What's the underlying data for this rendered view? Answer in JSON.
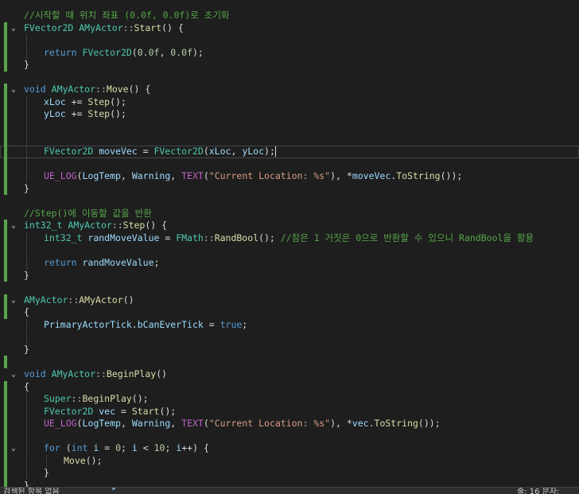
{
  "editor": {
    "language": "cpp",
    "current_line_index": 11,
    "colors": {
      "background": "#1e1e1e",
      "keyword": "#569cd6",
      "type": "#4ec9b0",
      "comment": "#57a64a",
      "string": "#d69d85",
      "number": "#b5cea8",
      "function": "#dcdcaa",
      "default": "#dcdcdc",
      "change_bar": "#57a64a"
    },
    "lines": [
      {
        "indent": 0,
        "fold": "",
        "tokens": [
          {
            "k": "c",
            "t": "//시작할 때 위치 좌표 (0.0f, 0.0f)로 초기화"
          }
        ]
      },
      {
        "indent": 0,
        "fold": "v",
        "tokens": [
          {
            "k": "t",
            "t": "FVector2D"
          },
          {
            "k": "d",
            "t": " "
          },
          {
            "k": "t",
            "t": "AMyActor"
          },
          {
            "k": "p",
            "t": "::"
          },
          {
            "k": "f",
            "t": "Start"
          },
          {
            "k": "d",
            "t": "() {"
          }
        ]
      },
      {
        "indent": 1,
        "fold": "",
        "tokens": []
      },
      {
        "indent": 1,
        "fold": "",
        "tokens": [
          {
            "k": "k",
            "t": "return"
          },
          {
            "k": "d",
            "t": " "
          },
          {
            "k": "t",
            "t": "FVector2D"
          },
          {
            "k": "d",
            "t": "("
          },
          {
            "k": "n",
            "t": "0.0f"
          },
          {
            "k": "d",
            "t": ", "
          },
          {
            "k": "n",
            "t": "0.0f"
          },
          {
            "k": "d",
            "t": ");"
          }
        ]
      },
      {
        "indent": 0,
        "fold": "",
        "tokens": [
          {
            "k": "d",
            "t": "}"
          }
        ]
      },
      {
        "indent": 0,
        "fold": "",
        "tokens": []
      },
      {
        "indent": 0,
        "fold": "v",
        "tokens": [
          {
            "k": "k",
            "t": "void"
          },
          {
            "k": "d",
            "t": " "
          },
          {
            "k": "t",
            "t": "AMyActor"
          },
          {
            "k": "p",
            "t": "::"
          },
          {
            "k": "f",
            "t": "Move"
          },
          {
            "k": "d",
            "t": "() {"
          }
        ]
      },
      {
        "indent": 1,
        "fold": "",
        "tokens": [
          {
            "k": "v",
            "t": "xLoc"
          },
          {
            "k": "d",
            "t": " += "
          },
          {
            "k": "f",
            "t": "Step"
          },
          {
            "k": "d",
            "t": "();"
          }
        ]
      },
      {
        "indent": 1,
        "fold": "",
        "tokens": [
          {
            "k": "v",
            "t": "yLoc"
          },
          {
            "k": "d",
            "t": " += "
          },
          {
            "k": "f",
            "t": "Step"
          },
          {
            "k": "d",
            "t": "();"
          }
        ]
      },
      {
        "indent": 1,
        "fold": "",
        "tokens": []
      },
      {
        "indent": 1,
        "fold": "",
        "tokens": []
      },
      {
        "indent": 1,
        "fold": "",
        "tokens": [
          {
            "k": "t",
            "t": "FVector2D"
          },
          {
            "k": "d",
            "t": " "
          },
          {
            "k": "v",
            "t": "moveVec"
          },
          {
            "k": "d",
            "t": " = "
          },
          {
            "k": "t",
            "t": "FVector2D"
          },
          {
            "k": "d",
            "t": "("
          },
          {
            "k": "v",
            "t": "xLoc"
          },
          {
            "k": "d",
            "t": ", "
          },
          {
            "k": "v",
            "t": "yLoc"
          },
          {
            "k": "d",
            "t": ");"
          }
        ]
      },
      {
        "indent": 1,
        "fold": "",
        "tokens": []
      },
      {
        "indent": 1,
        "fold": "",
        "tokens": [
          {
            "k": "m",
            "t": "UE_LOG"
          },
          {
            "k": "d",
            "t": "("
          },
          {
            "k": "v",
            "t": "LogTemp"
          },
          {
            "k": "d",
            "t": ", "
          },
          {
            "k": "v",
            "t": "Warning"
          },
          {
            "k": "d",
            "t": ", "
          },
          {
            "k": "m",
            "t": "TEXT"
          },
          {
            "k": "d",
            "t": "("
          },
          {
            "k": "s",
            "t": "\"Current Location: %s\""
          },
          {
            "k": "d",
            "t": "), *"
          },
          {
            "k": "v",
            "t": "moveVec"
          },
          {
            "k": "d",
            "t": "."
          },
          {
            "k": "f",
            "t": "ToString"
          },
          {
            "k": "d",
            "t": "());"
          }
        ]
      },
      {
        "indent": 0,
        "fold": "",
        "tokens": [
          {
            "k": "d",
            "t": "}"
          }
        ]
      },
      {
        "indent": 0,
        "fold": "",
        "tokens": []
      },
      {
        "indent": 0,
        "fold": "",
        "tokens": [
          {
            "k": "c",
            "t": "//Step()에 이동할 값을 반환"
          }
        ]
      },
      {
        "indent": 0,
        "fold": "v",
        "tokens": [
          {
            "k": "t",
            "t": "int32_t"
          },
          {
            "k": "d",
            "t": " "
          },
          {
            "k": "t",
            "t": "AMyActor"
          },
          {
            "k": "p",
            "t": "::"
          },
          {
            "k": "f",
            "t": "Step"
          },
          {
            "k": "d",
            "t": "() {"
          }
        ]
      },
      {
        "indent": 1,
        "fold": "",
        "tokens": [
          {
            "k": "t",
            "t": "int32_t"
          },
          {
            "k": "d",
            "t": " "
          },
          {
            "k": "v",
            "t": "randMoveValue"
          },
          {
            "k": "d",
            "t": " = "
          },
          {
            "k": "t",
            "t": "FMath"
          },
          {
            "k": "p",
            "t": "::"
          },
          {
            "k": "f",
            "t": "RandBool"
          },
          {
            "k": "d",
            "t": "(); "
          },
          {
            "k": "c",
            "t": "//참은 1 거짓은 0으로 반환할 수 있으니 RandBool을 활용"
          }
        ]
      },
      {
        "indent": 1,
        "fold": "",
        "tokens": []
      },
      {
        "indent": 1,
        "fold": "",
        "tokens": [
          {
            "k": "k",
            "t": "return"
          },
          {
            "k": "d",
            "t": " "
          },
          {
            "k": "v",
            "t": "randMoveValue"
          },
          {
            "k": "d",
            "t": ";"
          }
        ]
      },
      {
        "indent": 0,
        "fold": "",
        "tokens": [
          {
            "k": "d",
            "t": "}"
          }
        ]
      },
      {
        "indent": 0,
        "fold": "",
        "tokens": []
      },
      {
        "indent": 0,
        "fold": "v",
        "tokens": [
          {
            "k": "t",
            "t": "AMyActor"
          },
          {
            "k": "p",
            "t": "::"
          },
          {
            "k": "f",
            "t": "AMyActor"
          },
          {
            "k": "d",
            "t": "()"
          }
        ]
      },
      {
        "indent": 0,
        "fold": "",
        "tokens": [
          {
            "k": "d",
            "t": "{"
          }
        ]
      },
      {
        "indent": 1,
        "fold": "",
        "tokens": [
          {
            "k": "v",
            "t": "PrimaryActorTick"
          },
          {
            "k": "d",
            "t": "."
          },
          {
            "k": "v",
            "t": "bCanEverTick"
          },
          {
            "k": "d",
            "t": " = "
          },
          {
            "k": "k",
            "t": "true"
          },
          {
            "k": "d",
            "t": ";"
          }
        ]
      },
      {
        "indent": 1,
        "fold": "",
        "tokens": []
      },
      {
        "indent": 0,
        "fold": "",
        "tokens": [
          {
            "k": "d",
            "t": "}"
          }
        ]
      },
      {
        "indent": 0,
        "fold": "",
        "tokens": []
      },
      {
        "indent": 0,
        "fold": "v",
        "tokens": [
          {
            "k": "k",
            "t": "void"
          },
          {
            "k": "d",
            "t": " "
          },
          {
            "k": "t",
            "t": "AMyActor"
          },
          {
            "k": "p",
            "t": "::"
          },
          {
            "k": "f",
            "t": "BeginPlay"
          },
          {
            "k": "d",
            "t": "()"
          }
        ]
      },
      {
        "indent": 0,
        "fold": "",
        "tokens": [
          {
            "k": "d",
            "t": "{"
          }
        ]
      },
      {
        "indent": 1,
        "fold": "",
        "tokens": [
          {
            "k": "t",
            "t": "Super"
          },
          {
            "k": "p",
            "t": "::"
          },
          {
            "k": "f",
            "t": "BeginPlay"
          },
          {
            "k": "d",
            "t": "();"
          }
        ]
      },
      {
        "indent": 1,
        "fold": "",
        "tokens": [
          {
            "k": "t",
            "t": "FVector2D"
          },
          {
            "k": "d",
            "t": " "
          },
          {
            "k": "v",
            "t": "vec"
          },
          {
            "k": "d",
            "t": " = "
          },
          {
            "k": "f",
            "t": "Start"
          },
          {
            "k": "d",
            "t": "();"
          }
        ]
      },
      {
        "indent": 1,
        "fold": "",
        "tokens": [
          {
            "k": "m",
            "t": "UE_LOG"
          },
          {
            "k": "d",
            "t": "("
          },
          {
            "k": "v",
            "t": "LogTemp"
          },
          {
            "k": "d",
            "t": ", "
          },
          {
            "k": "v",
            "t": "Warning"
          },
          {
            "k": "d",
            "t": ", "
          },
          {
            "k": "m",
            "t": "TEXT"
          },
          {
            "k": "d",
            "t": "("
          },
          {
            "k": "s",
            "t": "\"Current Location: %s\""
          },
          {
            "k": "d",
            "t": "), *"
          },
          {
            "k": "v",
            "t": "vec"
          },
          {
            "k": "d",
            "t": "."
          },
          {
            "k": "f",
            "t": "ToString"
          },
          {
            "k": "d",
            "t": "());"
          }
        ]
      },
      {
        "indent": 1,
        "fold": "",
        "tokens": []
      },
      {
        "indent": 1,
        "fold": "v",
        "tokens": [
          {
            "k": "k",
            "t": "for"
          },
          {
            "k": "d",
            "t": " ("
          },
          {
            "k": "k",
            "t": "int"
          },
          {
            "k": "d",
            "t": " "
          },
          {
            "k": "v",
            "t": "i"
          },
          {
            "k": "d",
            "t": " = "
          },
          {
            "k": "n",
            "t": "0"
          },
          {
            "k": "d",
            "t": "; "
          },
          {
            "k": "v",
            "t": "i"
          },
          {
            "k": "d",
            "t": " < "
          },
          {
            "k": "n",
            "t": "10"
          },
          {
            "k": "d",
            "t": "; "
          },
          {
            "k": "v",
            "t": "i"
          },
          {
            "k": "d",
            "t": "++) {"
          }
        ]
      },
      {
        "indent": 2,
        "fold": "",
        "tokens": [
          {
            "k": "f",
            "t": "Move"
          },
          {
            "k": "d",
            "t": "();"
          }
        ]
      },
      {
        "indent": 1,
        "fold": "",
        "tokens": [
          {
            "k": "d",
            "t": "}"
          }
        ]
      },
      {
        "indent": 0,
        "fold": "",
        "tokens": [
          {
            "k": "d",
            "t": "}"
          }
        ]
      }
    ]
  },
  "statusbar": {
    "left_text": "검색된 항목 없음",
    "right_text": "줄: 16    문자:"
  }
}
